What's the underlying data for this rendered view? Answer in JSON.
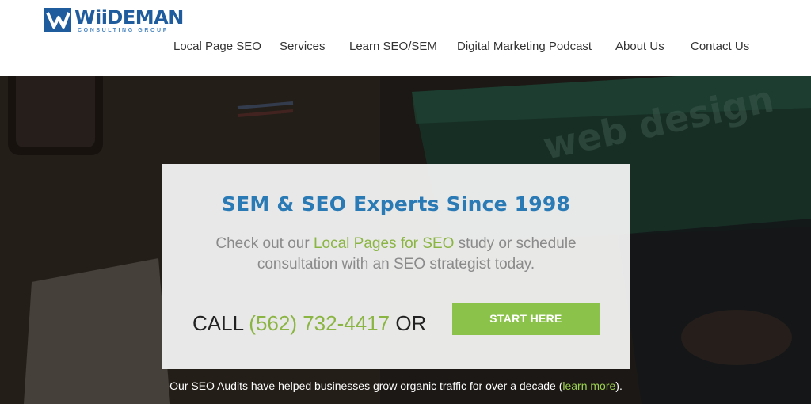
{
  "brand": {
    "name": "WiiDEMAN",
    "tagline": "CONSULTING GROUP",
    "colors": {
      "primary": "#1e5c9e",
      "accent_green": "#8bc34a",
      "link_green": "#8bb543",
      "title_blue": "#2a7ab6"
    }
  },
  "nav": {
    "items": [
      {
        "label": "Local Page SEO"
      },
      {
        "label": "Services"
      },
      {
        "label": "Learn SEO/SEM"
      },
      {
        "label": "Digital Marketing Podcast"
      },
      {
        "label": "About Us"
      },
      {
        "label": "Contact Us"
      }
    ]
  },
  "hero": {
    "background_text": "web design",
    "title": "SEM & SEO Experts Since 1998",
    "text_before": "Check out our ",
    "text_link": "Local Pages for SEO",
    "text_after": " study or schedule consultation with an SEO strategist today.",
    "call_prefix": "CALL ",
    "phone": "(562) 732-4417",
    "call_suffix": " OR",
    "cta_label": "START HERE",
    "audit_before": "Our SEO Audits have helped businesses grow organic traffic for over a decade (",
    "audit_link": "learn more",
    "audit_after": ")."
  }
}
